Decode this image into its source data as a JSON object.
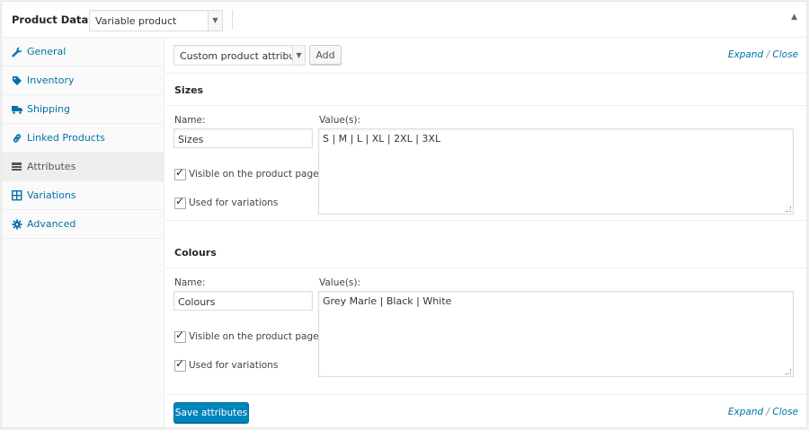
{
  "header": {
    "title": "Product Data —",
    "product_type": "Variable product"
  },
  "sidebar": {
    "items": [
      {
        "label": "General",
        "icon": "wrench-icon"
      },
      {
        "label": "Inventory",
        "icon": "tag-icon"
      },
      {
        "label": "Shipping",
        "icon": "truck-icon"
      },
      {
        "label": "Linked Products",
        "icon": "link-icon"
      },
      {
        "label": "Attributes",
        "icon": "list-icon"
      },
      {
        "label": "Variations",
        "icon": "grid-icon"
      },
      {
        "label": "Advanced",
        "icon": "gear-icon"
      }
    ],
    "active": "Attributes"
  },
  "toolbar": {
    "attribute_select": "Custom product attribute",
    "add_label": "Add",
    "expand": "Expand",
    "slash": "/",
    "close": "Close"
  },
  "attributes": [
    {
      "title": "Sizes",
      "name_label": "Name:",
      "name": "Sizes",
      "values_label": "Value(s):",
      "values": "S | M | L | XL | 2XL | 3XL",
      "visible_label": "Visible on the product page",
      "visible": true,
      "variations_label": "Used for variations",
      "variations": true
    },
    {
      "title": "Colours",
      "name_label": "Name:",
      "name": "Colours",
      "values_label": "Value(s):",
      "values": "Grey Marle | Black | White",
      "visible_label": "Visible on the product page",
      "visible": true,
      "variations_label": "Used for variations",
      "variations": true
    }
  ],
  "footer": {
    "save_label": "Save attributes",
    "expand": "Expand",
    "slash": "/",
    "close": "Close"
  },
  "colors": {
    "link": "#0073aa",
    "primary_button": "#0085ba"
  }
}
